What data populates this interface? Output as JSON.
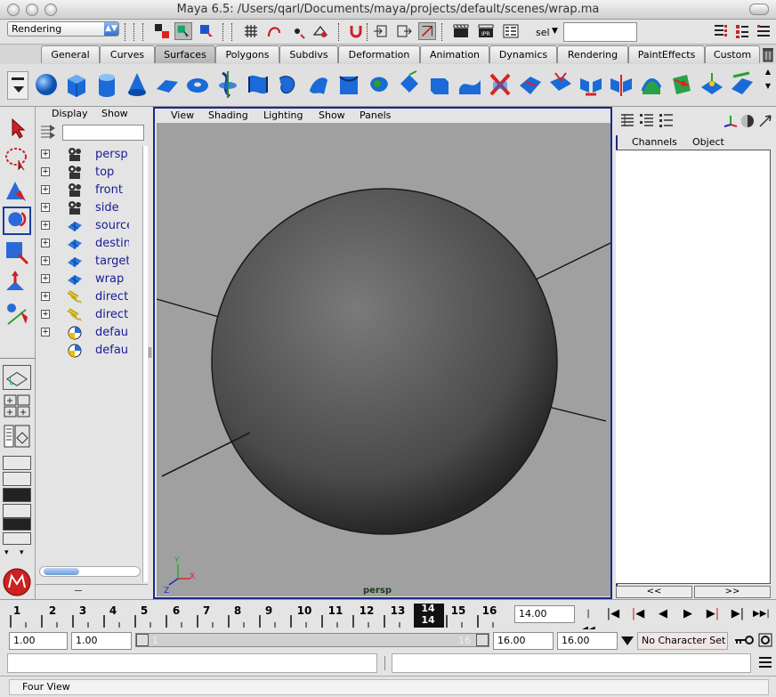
{
  "window": {
    "title": "Maya 6.5: /Users/qarl/Documents/maya/projects/default/scenes/wrap.ma"
  },
  "status_line": {
    "mode": "Rendering",
    "sel_label": "sel",
    "sel_value": ""
  },
  "shelf_tabs": [
    "General",
    "Curves",
    "Surfaces",
    "Polygons",
    "Subdivs",
    "Deformation",
    "Animation",
    "Dynamics",
    "Rendering",
    "PaintEffects",
    "Custom"
  ],
  "active_tab": "Surfaces",
  "outliner": {
    "menu": [
      "Display",
      "Show"
    ],
    "filter_value": "",
    "items": [
      {
        "label": "persp",
        "icon": "camera-icon",
        "expand": true
      },
      {
        "label": "top",
        "icon": "camera-icon",
        "expand": true
      },
      {
        "label": "front",
        "icon": "camera-icon",
        "expand": true
      },
      {
        "label": "side",
        "icon": "camera-icon",
        "expand": true
      },
      {
        "label": "source",
        "icon": "nurbs-surface-icon",
        "expand": true
      },
      {
        "label": "destin",
        "icon": "nurbs-surface-icon",
        "expand": true
      },
      {
        "label": "target",
        "icon": "nurbs-surface-icon",
        "expand": true
      },
      {
        "label": "wrap",
        "icon": "nurbs-surface-icon",
        "expand": true
      },
      {
        "label": "direct",
        "icon": "directional-light-icon",
        "expand": true
      },
      {
        "label": "direct",
        "icon": "directional-light-icon",
        "expand": true
      },
      {
        "label": "defaul",
        "icon": "light-set-icon",
        "expand": true
      },
      {
        "label": "defaul",
        "icon": "light-set-icon",
        "expand": false
      }
    ]
  },
  "viewport": {
    "menu": [
      "View",
      "Shading",
      "Lighting",
      "Show",
      "Panels"
    ],
    "camera_label": "persp",
    "axis_x": "X",
    "axis_y": "Y",
    "axis_z": "Z"
  },
  "channel_box": {
    "headers": [
      "Channels",
      "Object"
    ],
    "nav_prev": "<<",
    "nav_next": ">>"
  },
  "time_slider": {
    "ticks": [
      "1",
      "2",
      "3",
      "4",
      "5",
      "6",
      "7",
      "8",
      "9",
      "10",
      "11",
      "12",
      "13",
      "14",
      "15",
      "16"
    ],
    "current_frame": "14.00",
    "current_marker_top": "14",
    "current_marker_bottom": "14"
  },
  "range_slider": {
    "start": "1.00",
    "anim_start": "1.00",
    "range_left": "1",
    "range_right": "16",
    "anim_end": "16.00",
    "end": "16.00",
    "character_set": "No Character Set"
  },
  "help_line": {
    "text": "Four View"
  },
  "colors": {
    "viewport_bg": "#a0a0a0",
    "panel_border": "#1a2a8a",
    "accent_blue": "#2f6fd0"
  }
}
